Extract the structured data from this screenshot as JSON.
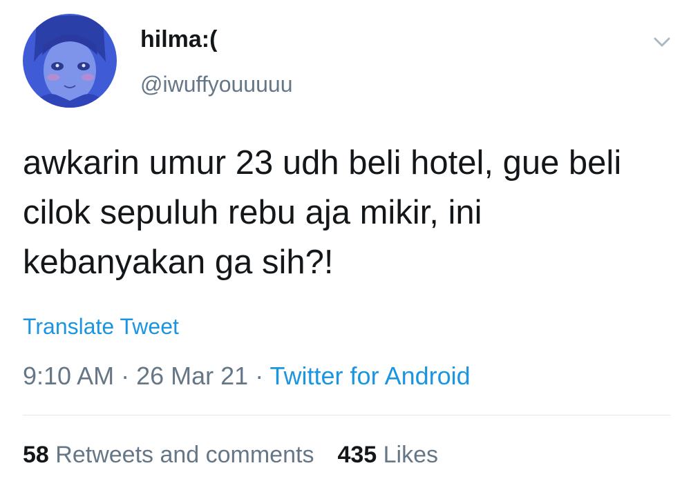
{
  "tweet": {
    "display_name": "hilma:(",
    "handle": "@iwuffyouuuuu",
    "text": "awkarin umur 23 udh beli hotel, gue beli cilok sepuluh rebu aja mikir, ini kebanyakan ga sih?!",
    "translate_label": "Translate Tweet",
    "time": "9:10 AM",
    "separator": " · ",
    "date": "26 Mar 21",
    "source": "Twitter for Android",
    "retweets_count": "58",
    "retweets_label": "Retweets and comments",
    "likes_count": "435",
    "likes_label": "Likes"
  },
  "icons": {
    "more": "chevron-down-icon",
    "avatar": "avatar-image"
  },
  "colors": {
    "link": "#1b95e0",
    "secondary_text": "#657786",
    "primary_text": "#14171a",
    "avatar_bg": "#3f5cd6"
  }
}
